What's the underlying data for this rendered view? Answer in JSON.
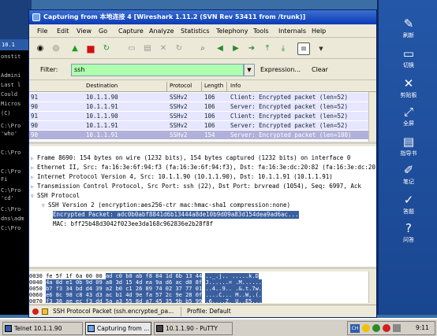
{
  "background_terminal": {
    "tab_label": "10.1",
    "lines": [
      "onstit",
      "Admini",
      "Last l",
      "Could",
      "Micros",
      "(C)",
      "C:\\Pro",
      "'who' ",
      "C:\\Pro",
      "",
      "C:\\Pro",
      "Fi",
      "C:\\Pro",
      "'cd'",
      "C:\\Pro",
      "dns\\adm",
      "C:\\Pro"
    ]
  },
  "window": {
    "title": "Capturing from 本地连接 4    [Wireshark 1.11.2  (SVN Rev 53411 from /trunk)]"
  },
  "menu": [
    "File",
    "Edit",
    "View",
    "Go",
    "Capture",
    "Analyze",
    "Statistics",
    "Telephony",
    "Tools",
    "Internals",
    "Help"
  ],
  "filter": {
    "label": "Filter:",
    "value": "ssh",
    "expression_label": "Expression...",
    "clear_label": "Clear"
  },
  "packet_list": {
    "columns": [
      "Destination",
      "Protocol",
      "Length",
      "Info"
    ],
    "rows": [
      {
        "src": "91",
        "dst": "10.1.1.90",
        "proto": "SSHv2",
        "len": "106",
        "info": "Client: Encrypted packet (len=52)",
        "selected": false
      },
      {
        "src": "90",
        "dst": "10.1.1.91",
        "proto": "SSHv2",
        "len": "106",
        "info": "Server: Encrypted packet (len=52)",
        "selected": false
      },
      {
        "src": "91",
        "dst": "10.1.1.90",
        "proto": "SSHv2",
        "len": "106",
        "info": "Client: Encrypted packet (len=52)",
        "selected": false
      },
      {
        "src": "90",
        "dst": "10.1.1.91",
        "proto": "SSHv2",
        "len": "106",
        "info": "Server: Encrypted packet (len=52)",
        "selected": false
      },
      {
        "src": "90",
        "dst": "10.1.1.91",
        "proto": "SSHv2",
        "len": "154",
        "info": "Server: Encrypted packet (len=100)",
        "selected": true
      }
    ]
  },
  "details": {
    "lines": [
      {
        "indent": 0,
        "expander": "▷",
        "text": "Frame 8690: 154 bytes on wire (1232 bits), 154 bytes captured (1232 bits) on interface 0",
        "highlight": false
      },
      {
        "indent": 0,
        "expander": "▷",
        "text": "Ethernet II, Src: fa:16:3e:6f:94:f3 (fa:16:3e:6f:94:f3), Dst: fa:16:3e:dc:20:82 (fa:16:3e:dc:20:82)",
        "highlight": false
      },
      {
        "indent": 0,
        "expander": "▷",
        "text": "Internet Protocol Version 4, Src: 10.1.1.90 (10.1.1.90), Dst: 10.1.1.91 (10.1.1.91)",
        "highlight": false
      },
      {
        "indent": 0,
        "expander": "▷",
        "text": "Transmission Control Protocol, Src Port: ssh (22), Dst Port: brvread (1054), Seq: 6997, Ack",
        "highlight": false
      },
      {
        "indent": 0,
        "expander": "▽",
        "text": "SSH Protocol",
        "highlight": false
      },
      {
        "indent": 1,
        "expander": "▽",
        "text": "SSH Version 2 (encryption:aes256-ctr mac:hmac-sha1 compression:none)",
        "highlight": false
      },
      {
        "indent": 2,
        "expander": "",
        "text": "Encrypted Packet: adc0b0abf8841d6b13444a8de10b9d09a83d154dea9ad6ac...",
        "highlight": true
      },
      {
        "indent": 2,
        "expander": "",
        "text": "MAC: bff25b48d3042f023ee3da168c962836e2b28f8f",
        "highlight": false
      }
    ]
  },
  "bytes": {
    "lines": [
      {
        "offset": "0030",
        "hex_plain": "fe 5f 1f 6a 00 00 ",
        "hex_hl": "ad c0  b0 ab f8 84 1d 6b 13 44",
        "ascii": ".._.j.. .....k.D"
      },
      {
        "offset": "0040",
        "hex_plain": "",
        "hex_hl": "4a 8d e1 0b 9d 09 a8 3d  15 4d ea 9a d6 ac d0 8f",
        "ascii": "J......= .M......"
      },
      {
        "offset": "0050",
        "hex_plain": "",
        "hex_hl": "b7 f3 34 bd d4 39 a2 b0  c1 26 89 74 02 37 77 01",
        "ascii": "..4..9.. .&.t.7w."
      },
      {
        "offset": "0060",
        "hex_plain": "",
        "hex_hl": "e6 8c 98 c8 43 d3 ac b1  4d 9e fa 57 2c 9e 28 0f",
        "ascii": "....C... M..W,.(."
      },
      {
        "offset": "0070",
        "hex_plain": "",
        "hex_hl": "f3 36 ae ec f3 dd 5a a3  55 8d a7 45 35 9b b5 99",
        "ascii": ".6....Z. U..E5..."
      }
    ]
  },
  "status": {
    "field_text": "SSH Protocol Packet (ssh.encrypted_pa...",
    "profile_text": "Profile: Default"
  },
  "sidebar": [
    {
      "icon": "new-icon",
      "glyph": "✎",
      "label": "刷新"
    },
    {
      "icon": "monitor-icon",
      "glyph": "▭",
      "label": "切换"
    },
    {
      "icon": "tools-icon",
      "glyph": "✕",
      "label": "剪贴板"
    },
    {
      "icon": "fullscreen-icon",
      "glyph": "⤢",
      "label": "全屏"
    },
    {
      "icon": "book-icon",
      "glyph": "▤",
      "label": "指导书"
    },
    {
      "icon": "pen-icon",
      "glyph": "✐",
      "label": "笔记"
    },
    {
      "icon": "answer-icon",
      "glyph": "✓",
      "label": "答题"
    },
    {
      "icon": "question-icon",
      "glyph": "?",
      "label": "问答"
    }
  ],
  "taskbar": {
    "tasks": [
      "Telnet 10.1.1.90",
      "Capturing from ...",
      "10.1.1.90 - PuTTY"
    ],
    "clock": "9:11",
    "ime": "CH"
  }
}
